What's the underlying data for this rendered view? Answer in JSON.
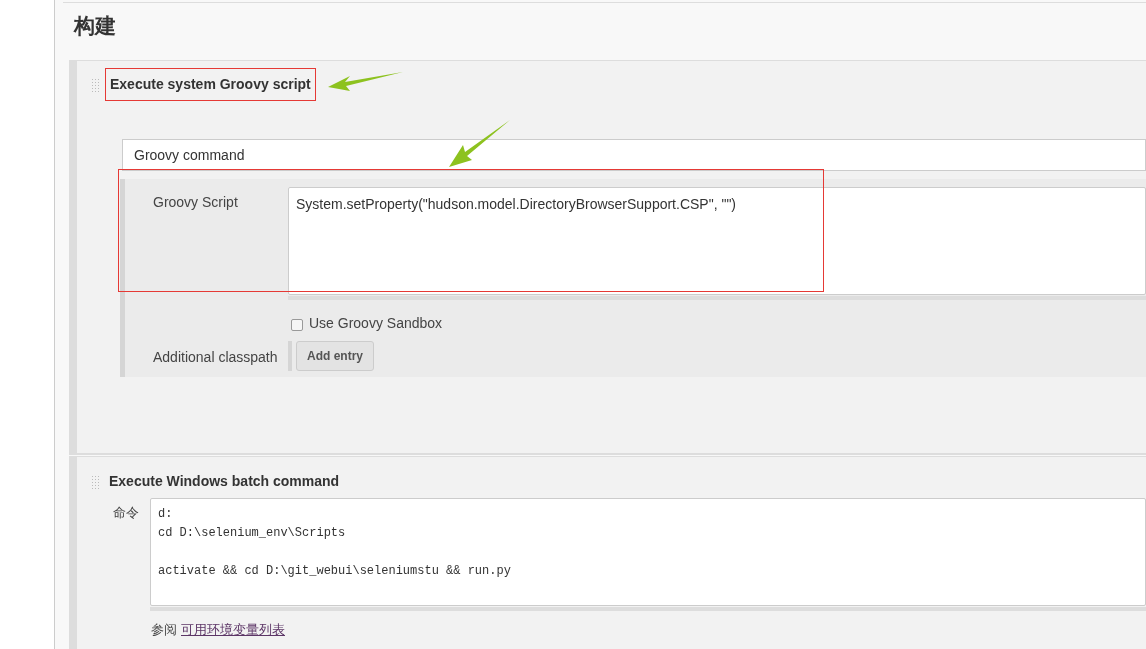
{
  "heading": "构建",
  "steps": [
    {
      "kind": "groovy",
      "title": "Execute system Groovy script",
      "command_type": "Groovy command",
      "script_label": "Groovy Script",
      "script": "System.setProperty(\"hudson.model.DirectoryBrowserSupport.CSP\", \"\")",
      "sandbox": {
        "label": "Use Groovy Sandbox",
        "checked": false
      },
      "classpath_label": "Additional classpath",
      "add_button": "Add entry"
    },
    {
      "kind": "batch",
      "title": "Execute Windows batch command",
      "command_label": "命令",
      "command": "d:\ncd D:\\selenium_env\\Scripts\n\nactivate && cd D:\\git_webui\\seleniumstu && run.py",
      "see_also": "参阅",
      "link": "可用环境变量列表"
    }
  ]
}
